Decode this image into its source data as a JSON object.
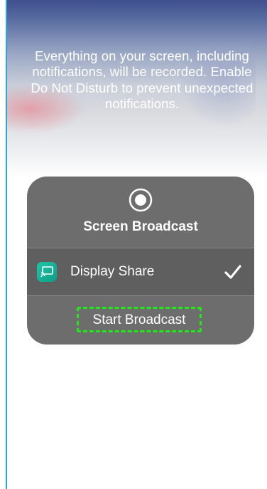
{
  "overlay": {
    "message": "Everything on your screen, including notifications, will be recorded. Enable Do Not Disturb to prevent unexpected notifications."
  },
  "broadcast_panel": {
    "title": "Screen Broadcast",
    "title_icon": "record-icon",
    "selected_app": {
      "label": "Display Share",
      "icon": "screen-share-icon",
      "selected": true,
      "selected_icon": "checkmark-icon"
    },
    "start_button_label": "Start Broadcast"
  },
  "colors": {
    "panel_background": "#6d6d6d",
    "selected_row_background": "#5f5f5f",
    "highlight_outline": "#22e81a",
    "app_icon_teal": "#1fc7a8",
    "left_edge_blue": "#2aa6df"
  }
}
